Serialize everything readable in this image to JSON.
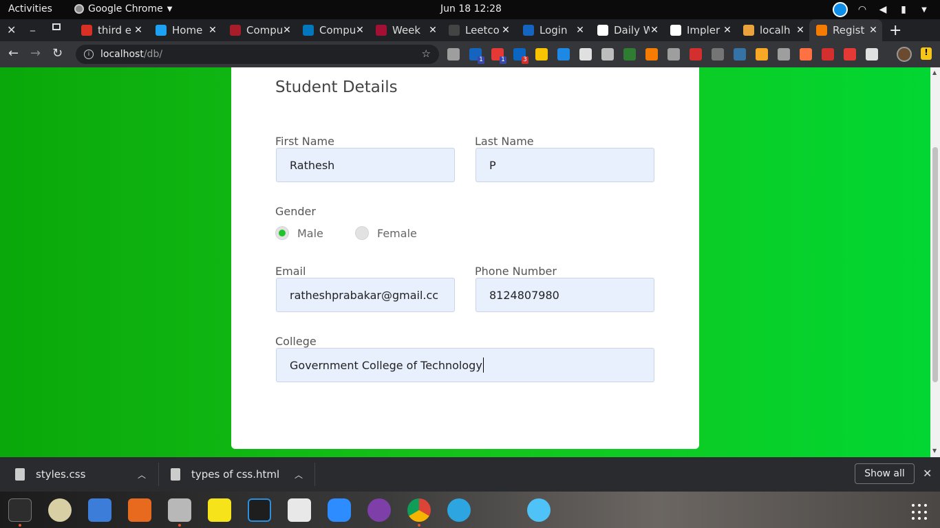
{
  "topbar": {
    "activities": "Activities",
    "app_name": "Google Chrome",
    "clock": "Jun 18  12:28"
  },
  "tabs": [
    {
      "title": "third e",
      "color": "#d93025"
    },
    {
      "title": "Home",
      "color": "#1da1f2"
    },
    {
      "title": "Compu",
      "color": "#a81d2a"
    },
    {
      "title": "Compu",
      "color": "#0277bd"
    },
    {
      "title": "Week",
      "color": "#a41034"
    },
    {
      "title": "Leetco",
      "color": "#444444"
    },
    {
      "title": "Login",
      "color": "#1565c0"
    },
    {
      "title": "Daily W",
      "color": "#ffffff"
    },
    {
      "title": "Impler",
      "color": "#ffffff"
    },
    {
      "title": "localh",
      "color": "#e8a33d"
    },
    {
      "title": "Regist",
      "color": "#f57c00"
    }
  ],
  "omnibox": {
    "host": "localhost",
    "path": "/db/"
  },
  "extension_badges": [
    "1",
    "1",
    "3"
  ],
  "form": {
    "title": "Student Details",
    "first_name_label": "First Name",
    "first_name_value": "Rathesh",
    "last_name_label": "Last Name",
    "last_name_value": "P",
    "gender_label": "Gender",
    "gender_male": "Male",
    "gender_female": "Female",
    "gender_selected": "Male",
    "email_label": "Email",
    "email_value": "ratheshprabakar@gmail.cc",
    "phone_label": "Phone Number",
    "phone_value": "8124807980",
    "college_label": "College",
    "college_value": "Government College of Technology"
  },
  "downloads": {
    "items": [
      "styles.css",
      "types of css.html"
    ],
    "show_all": "Show all"
  }
}
